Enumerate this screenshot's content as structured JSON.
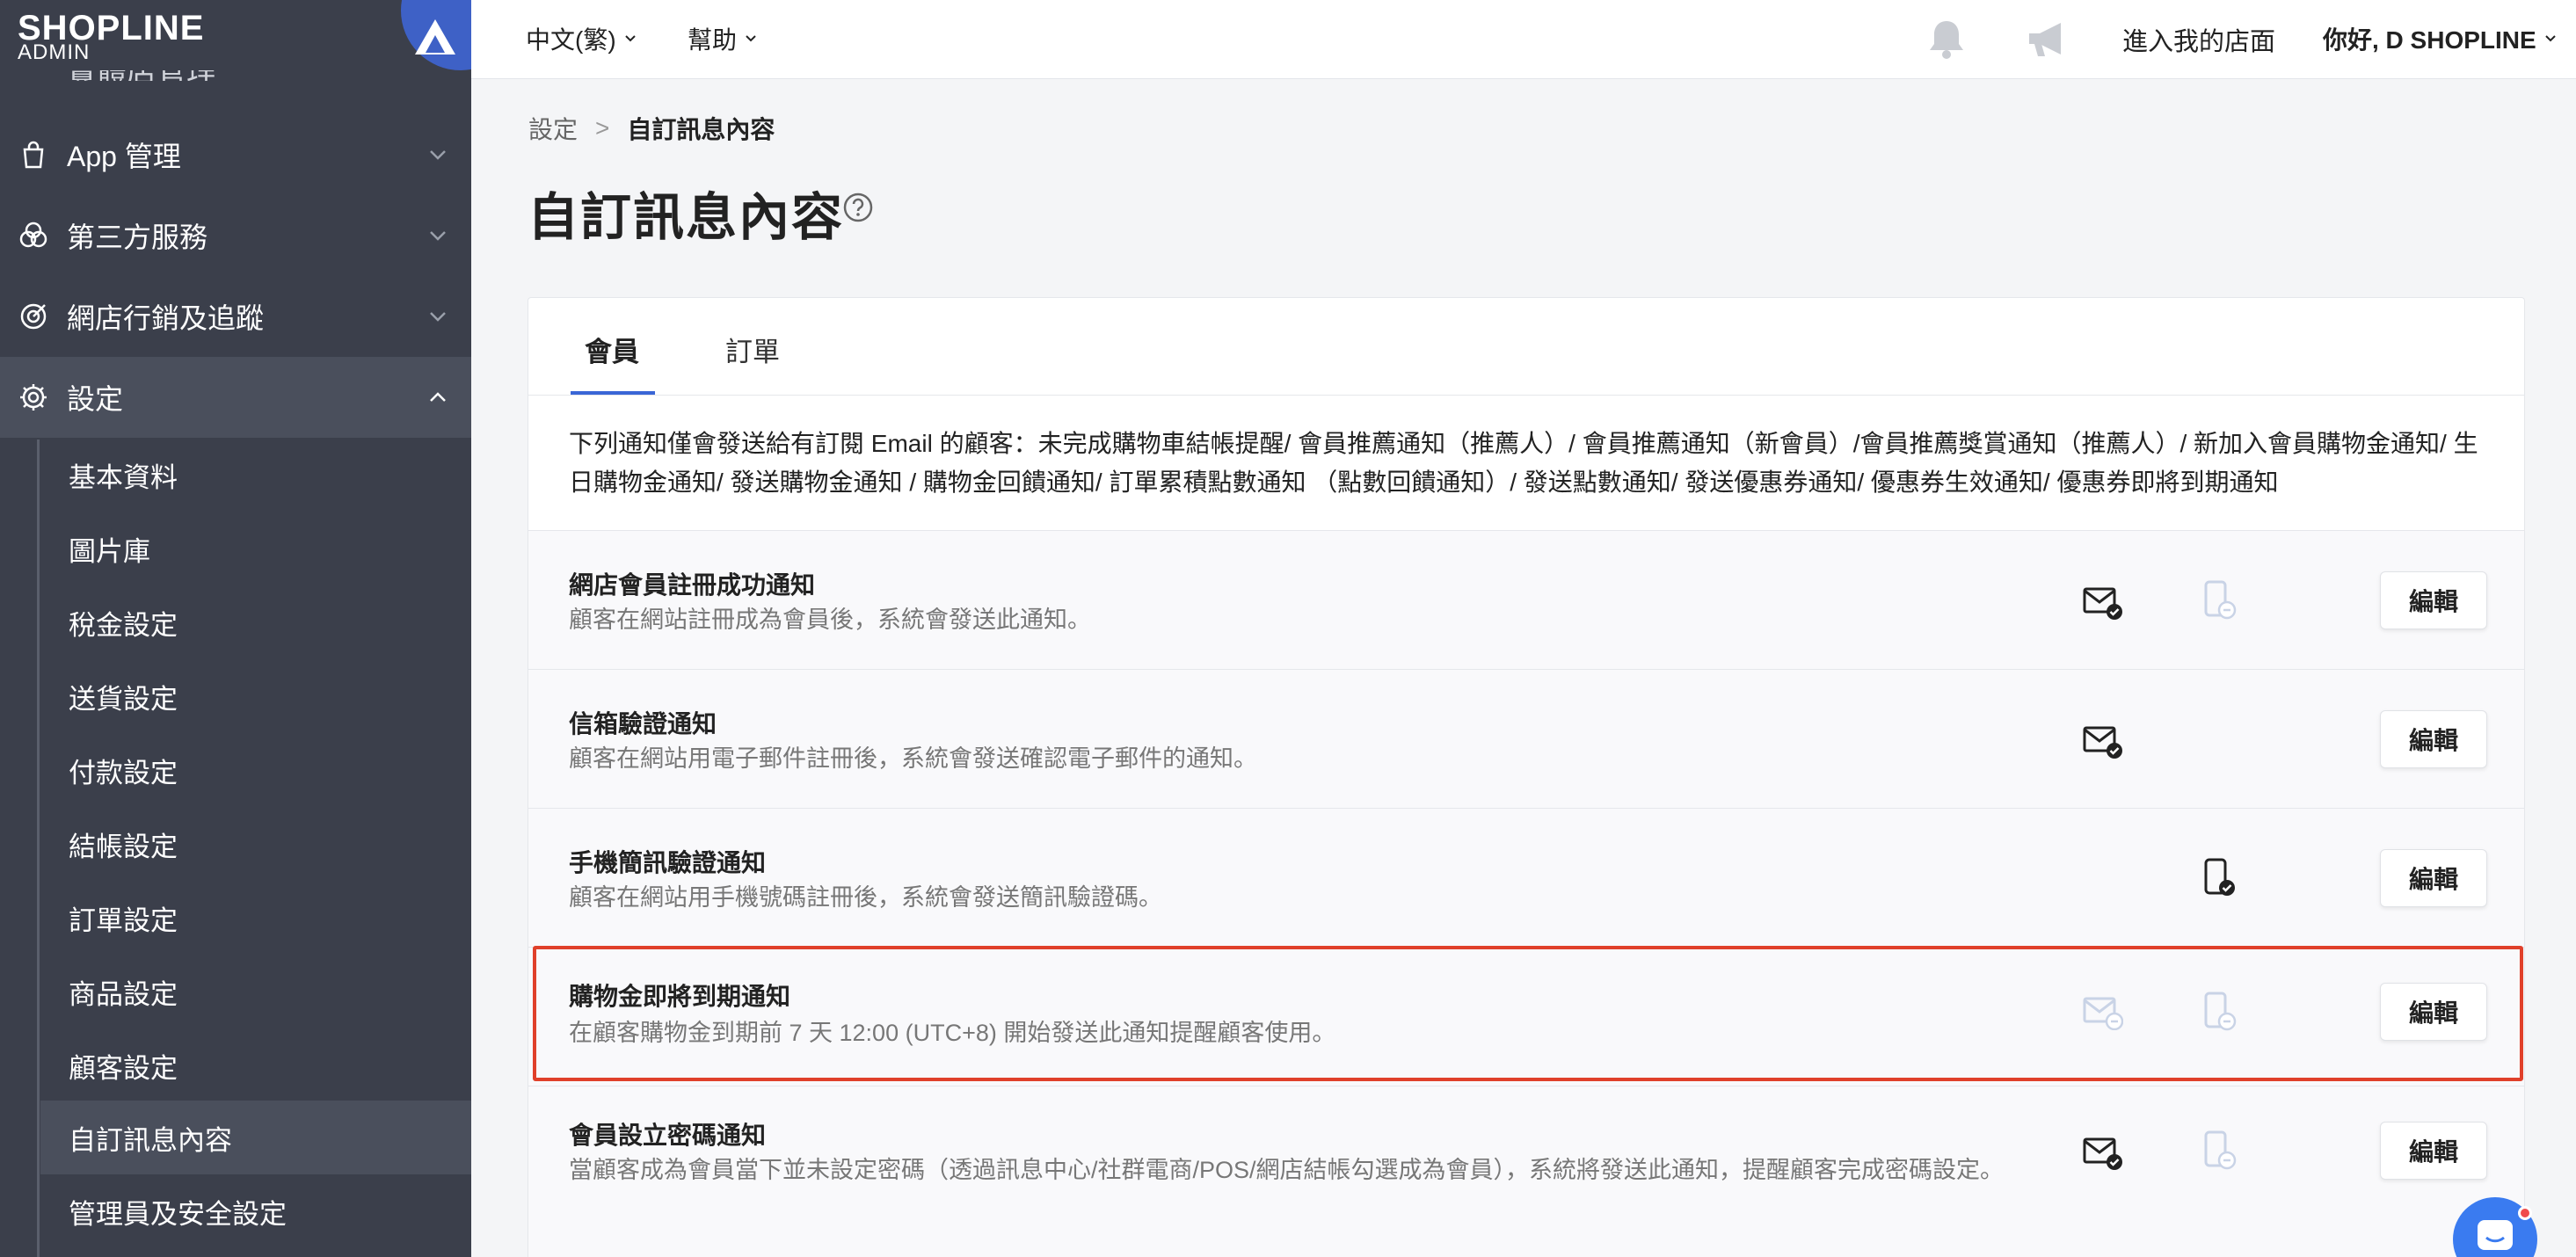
{
  "brand": {
    "name": "SHOPLINE",
    "sub": "ADMIN"
  },
  "topbar": {
    "language": "中文(繁)",
    "help": "幫助",
    "store_link": "進入我的店面",
    "greeting": "你好, D SHOPLINE"
  },
  "sidebar": {
    "cut_item": "實體店管理",
    "items": [
      {
        "label": "App 管理",
        "icon": "bag-icon"
      },
      {
        "label": "第三方服務",
        "icon": "circles-icon"
      },
      {
        "label": "網店行銷及追蹤",
        "icon": "target-icon"
      },
      {
        "label": "設定",
        "icon": "gear-icon"
      }
    ],
    "sub_items": [
      {
        "label": "基本資料"
      },
      {
        "label": "圖片庫"
      },
      {
        "label": "稅金設定"
      },
      {
        "label": "送貨設定"
      },
      {
        "label": "付款設定"
      },
      {
        "label": "結帳設定"
      },
      {
        "label": "訂單設定"
      },
      {
        "label": "商品設定"
      },
      {
        "label": "顧客設定"
      },
      {
        "label": "自訂訊息內容"
      },
      {
        "label": "管理員及安全設定"
      }
    ]
  },
  "breadcrumb": {
    "parent": "設定",
    "separator": ">",
    "current": "自訂訊息內容"
  },
  "page_title": "自訂訊息內容",
  "tabs": [
    {
      "label": "會員"
    },
    {
      "label": "訂單"
    }
  ],
  "notice": "下列通知僅會發送給有訂閱 Email 的顧客：未完成購物車結帳提醒/ 會員推薦通知（推薦人）/ 會員推薦通知（新會員）/會員推薦獎賞通知（推薦人）/ 新加入會員購物金通知/ 生日購物金通知/ 發送購物金通知 / 購物金回饋通知/ 訂單累積點數通知 （點數回饋通知）/ 發送點數通知/ 發送優惠券通知/ 優惠券生效通知/ 優惠券即將到期通知",
  "notifications": [
    {
      "title": "網店會員註冊成功通知",
      "desc": "顧客在網站註冊成為會員後，系統會發送此通知。",
      "email": "enabled",
      "sms": "disabled",
      "edit": "編輯"
    },
    {
      "title": "信箱驗證通知",
      "desc": "顧客在網站用電子郵件註冊後，系統會發送確認電子郵件的通知。",
      "email": "enabled",
      "sms": "none",
      "edit": "編輯"
    },
    {
      "title": "手機簡訊驗證通知",
      "desc": "顧客在網站用手機號碼註冊後，系統會發送簡訊驗證碼。",
      "email": "none",
      "sms": "enabled",
      "edit": "編輯"
    },
    {
      "title": "購物金即將到期通知",
      "desc": "在顧客購物金到期前 7 天 12:00 (UTC+8) 開始發送此通知提醒顧客使用。",
      "email": "disabled",
      "sms": "disabled",
      "edit": "編輯"
    },
    {
      "title": "會員設立密碼通知",
      "desc": "當顧客成為會員當下並未設定密碼（透過訊息中心/社群電商/POS/網店結帳勾選成為會員），系統將發送此通知，提醒顧客完成密碼設定。",
      "email": "enabled",
      "sms": "disabled",
      "edit": "編輯"
    }
  ],
  "colors": {
    "sidebar": "#3b3f4b",
    "accent": "#3a66d6",
    "highlight": "#e0402a"
  }
}
